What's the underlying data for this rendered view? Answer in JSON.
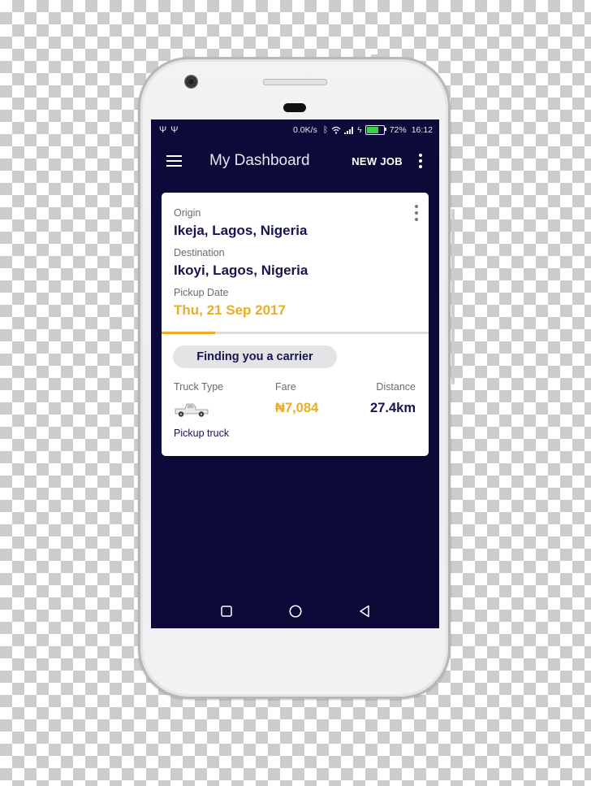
{
  "statusbar": {
    "left_icons": [
      "usb-icon",
      "usb-debug-icon"
    ],
    "network_speed": "0.0K/s",
    "battery_level": 0.72,
    "battery_text": "72%",
    "time": "16:12",
    "battery_color": "#38d046"
  },
  "appbar": {
    "title": "My Dashboard",
    "new_job_label": "NEW JOB",
    "background": "#0b0a38"
  },
  "job_card": {
    "origin_label": "Origin",
    "origin_value": "Ikeja, Lagos, Nigeria",
    "destination_label": "Destination",
    "destination_value": "Ikoyi, Lagos, Nigeria",
    "pickup_label": "Pickup Date",
    "pickup_value": "Thu, 21 Sep 2017",
    "progress": 0.2,
    "status_chip": "Finding you a carrier",
    "truck_type_label": "Truck Type",
    "truck_type_value": "Pickup truck",
    "fare_label": "Fare",
    "fare_value": "₦7,084",
    "distance_label": "Distance",
    "distance_value": "27.4km",
    "accent_color": "#e9ad27",
    "primary_text_color": "#15154f"
  },
  "navbar": {
    "buttons": [
      "recents-icon",
      "home-icon",
      "back-icon"
    ]
  }
}
